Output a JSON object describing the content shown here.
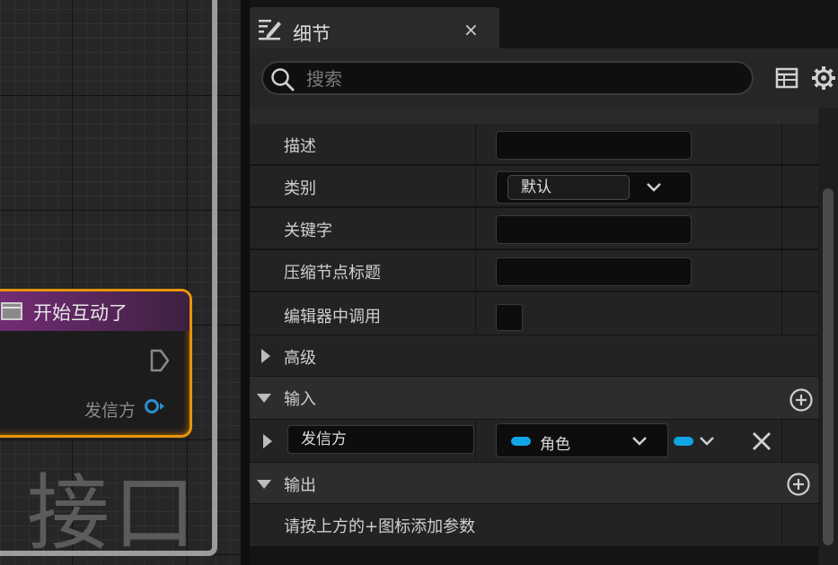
{
  "graph": {
    "node_title": "开始互动了",
    "pin_label": "发信方",
    "watermark": "接口"
  },
  "panel": {
    "tab_title": "细节",
    "close_symbol": "×",
    "search_placeholder": "搜索",
    "icons": [
      "pencil-icon",
      "search-icon",
      "table-view-icon",
      "gear-icon",
      "chevron-down-icon",
      "add-circle-icon",
      "close-icon"
    ],
    "properties": [
      {
        "label": "描述",
        "value": ""
      },
      {
        "label": "类别",
        "value": "默认"
      },
      {
        "label": "关键字",
        "value": ""
      },
      {
        "label": "压缩节点标题",
        "value": ""
      },
      {
        "label": "编辑器中调用",
        "checked": false
      }
    ],
    "advanced_label": "高级",
    "inputs_label": "输入",
    "input_param": {
      "name": "发信方",
      "type": "角色",
      "type_color": "#11a5e8"
    },
    "outputs_label": "输出",
    "outputs_hint": "请按上方的+图标添加参数"
  }
}
